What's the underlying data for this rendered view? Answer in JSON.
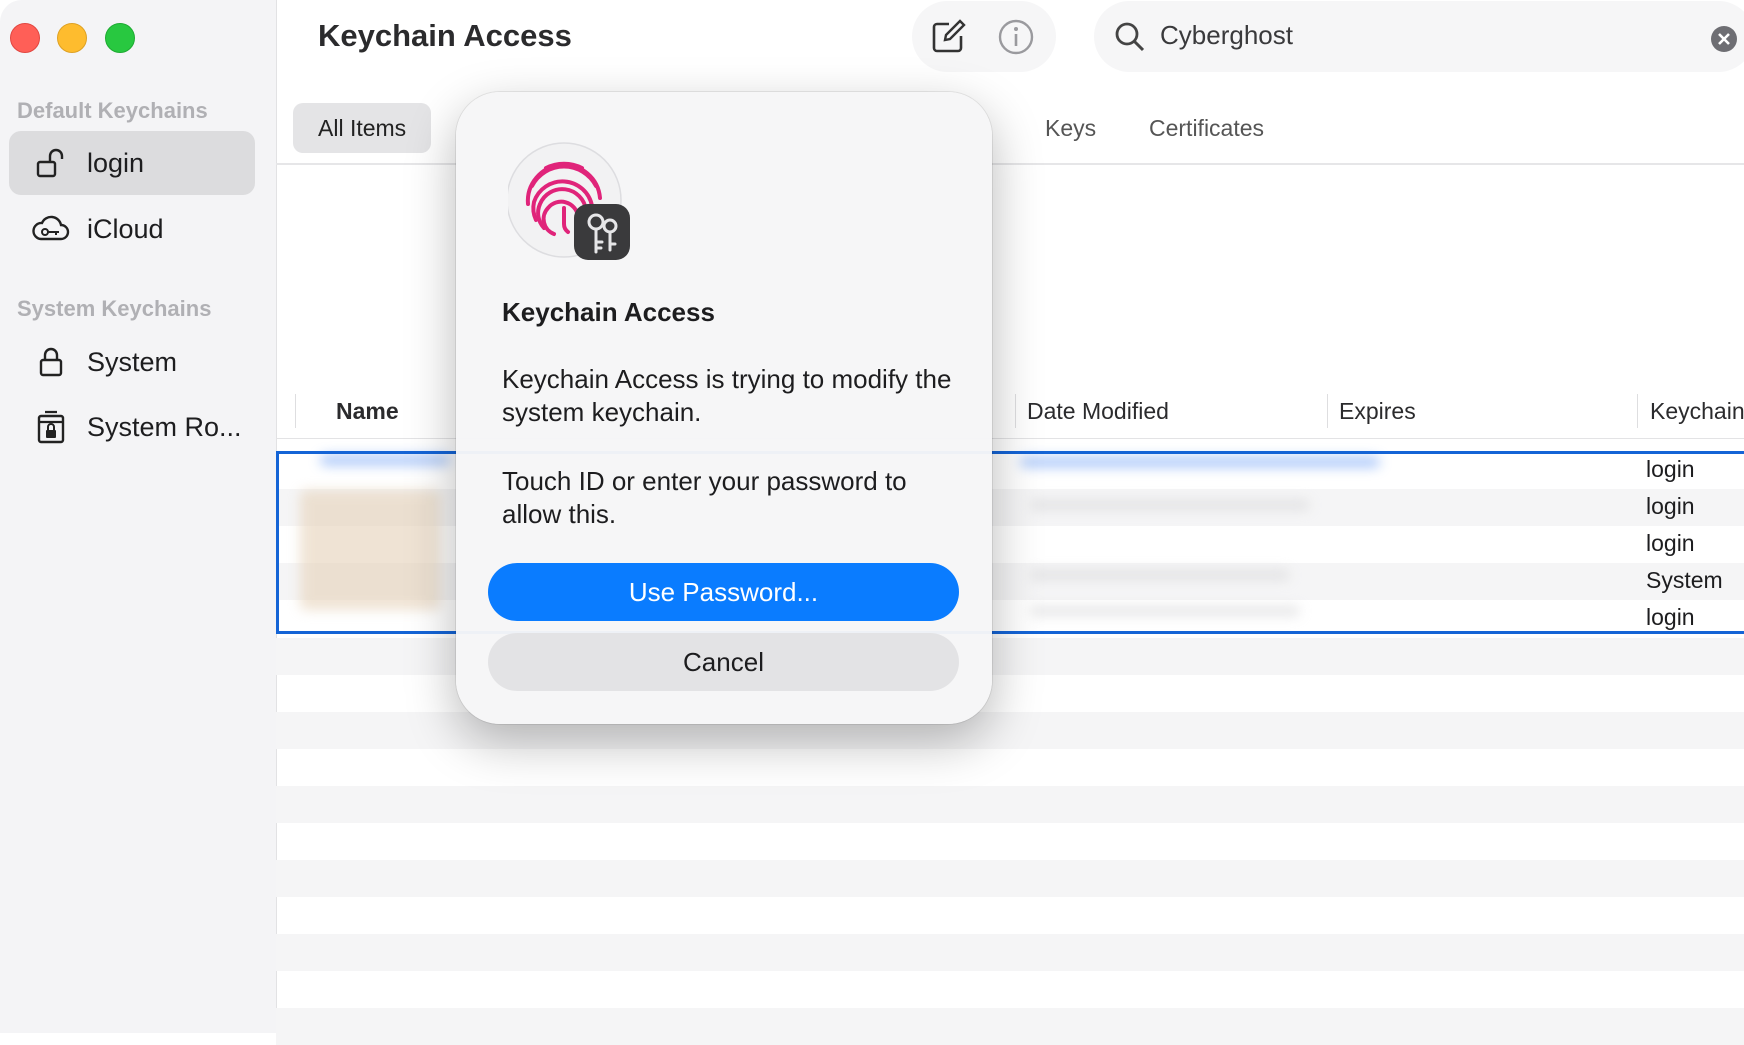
{
  "window": {
    "title": "Keychain Access"
  },
  "sidebar": {
    "sections": [
      {
        "label": "Default Keychains",
        "items": [
          {
            "label": "login",
            "icon": "unlocked-padlock-icon",
            "selected": true
          },
          {
            "label": "iCloud",
            "icon": "icloud-key-icon",
            "selected": false
          }
        ]
      },
      {
        "label": "System Keychains",
        "items": [
          {
            "label": "System",
            "icon": "lock-icon",
            "selected": false
          },
          {
            "label": "System Ro...",
            "icon": "locked-cabinet-icon",
            "selected": false
          }
        ]
      }
    ]
  },
  "toolbar": {
    "compose_icon": "compose-icon",
    "info_icon": "info-icon"
  },
  "search": {
    "value": "Cyberghost",
    "icon": "search-icon",
    "clear_icon": "clear-icon"
  },
  "tabs": [
    {
      "label": "All Items",
      "active": true
    },
    {
      "label": "Keys",
      "active": false
    },
    {
      "label": "Certificates",
      "active": false
    }
  ],
  "table": {
    "columns": [
      "Name",
      "Date Modified",
      "Expires",
      "Keychain"
    ],
    "rows": [
      {
        "keychain": "login"
      },
      {
        "keychain": "login"
      },
      {
        "keychain": "login"
      },
      {
        "keychain": "System"
      },
      {
        "keychain": "login"
      }
    ]
  },
  "dialog": {
    "title": "Keychain Access",
    "message_1": "Keychain Access is trying to modify the system keychain.",
    "message_2": "Touch ID or enter your password to allow this.",
    "primary_button": "Use Password...",
    "secondary_button": "Cancel",
    "icon": "touch-id-fingerprint-icon",
    "badge_icon": "keychain-keys-icon"
  },
  "colors": {
    "accent": "#0a7cff",
    "selection": "#1464d6",
    "fingerprint": "#e0247a"
  }
}
